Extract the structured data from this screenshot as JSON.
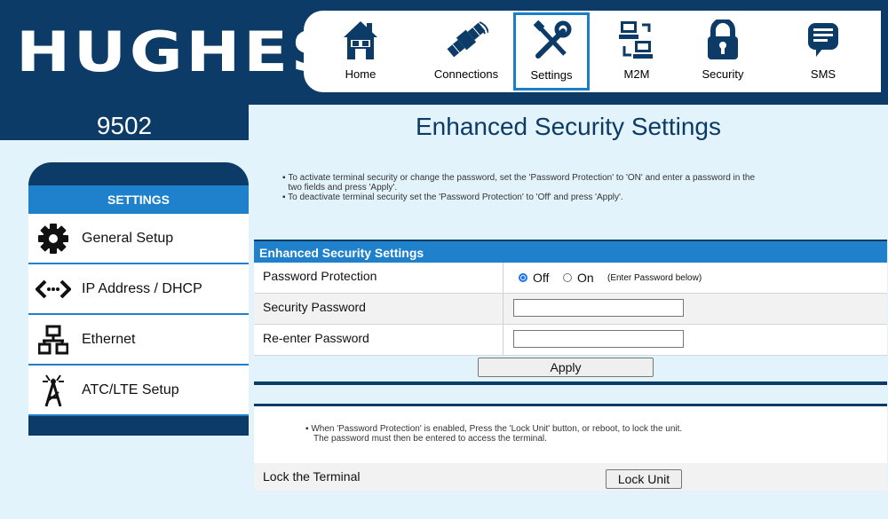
{
  "brand": {
    "logo": "HUGHES",
    "model": "9502"
  },
  "nav": [
    {
      "label": "Home",
      "icon": "home-icon"
    },
    {
      "label": "Connections",
      "icon": "satellite-icon"
    },
    {
      "label": "Settings",
      "icon": "tools-icon",
      "active": true
    },
    {
      "label": "M2M",
      "icon": "m2m-computers-icon"
    },
    {
      "label": "Security",
      "icon": "padlock-icon"
    },
    {
      "label": "SMS",
      "icon": "message-icon"
    }
  ],
  "page_title": "Enhanced Security Settings",
  "sidebar": {
    "header": "SETTINGS",
    "items": [
      {
        "label": "General Setup",
        "icon": "gear-icon"
      },
      {
        "label": "IP Address / DHCP",
        "icon": "arrows-icon"
      },
      {
        "label": "Ethernet",
        "icon": "network-icon"
      },
      {
        "label": "ATC/LTE Setup",
        "icon": "antenna-tower-icon"
      }
    ]
  },
  "notes": [
    "To activate terminal security or change the password, set the 'Password Protection' to 'ON' and enter a password in the two fields and press 'Apply'.",
    "To deactivate terminal security set the 'Password Protection' to 'Off' and press 'Apply'."
  ],
  "security_panel": {
    "header": "Enhanced Security Settings",
    "password_protection_label": "Password Protection",
    "radio_off": "Off",
    "radio_on": "On",
    "radio_selected": "Off",
    "radio_hint": "(Enter Password below)",
    "security_password_label": "Security Password",
    "security_password_value": "",
    "reenter_password_label": "Re-enter Password",
    "reenter_password_value": "",
    "apply_label": "Apply"
  },
  "lock_panel": {
    "note_line1": "When 'Password Protection' is enabled, Press the 'Lock Unit' button, or reboot, to lock the unit.",
    "note_line2": "The password must then be entered to access the terminal.",
    "lock_label": "Lock the Terminal",
    "lock_button": "Lock Unit"
  },
  "colors": {
    "dark_blue": "#0b3b66",
    "accent_blue": "#1f80cc",
    "background": "#e3f3fb"
  }
}
